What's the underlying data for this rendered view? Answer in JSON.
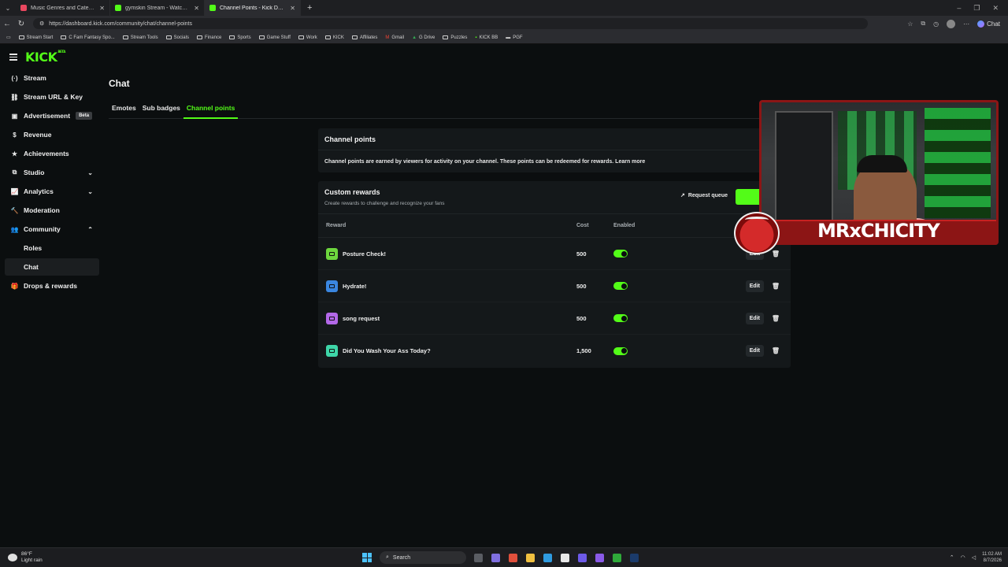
{
  "browser": {
    "tabs": [
      {
        "title": "Music Genres and Categories on /",
        "fav_color": "#e8475f",
        "active": false
      },
      {
        "title": "gymskin Stream - Watch Live",
        "fav_color": "#53fc18",
        "active": false
      },
      {
        "title": "Channel Points - Kick Dashboard",
        "fav_color": "#53fc18",
        "active": true
      }
    ],
    "url": "https://dashboard.kick.com/community/chat/channel-points",
    "chat_pill": "Chat",
    "bookmarks": [
      "Stream Start",
      "C Fam Fantasy Spo...",
      "Stream Tools",
      "Socials",
      "Finance",
      "Sports",
      "Game Stuff",
      "Work",
      "KICK",
      "Affiliates",
      "Gmail",
      "G Drive",
      "Puzzles",
      "KICK BB",
      "PGF"
    ]
  },
  "brand": {
    "logo": "KICK",
    "badge": "BETA",
    "accent": "#53fc18"
  },
  "sidebar": {
    "items": [
      {
        "label": "Stream",
        "icon": "(·)"
      },
      {
        "label": "Stream URL & Key",
        "icon": "⛓"
      },
      {
        "label": "Advertisement",
        "icon": "▣",
        "badge": "Beta"
      },
      {
        "label": "Revenue",
        "icon": "$"
      },
      {
        "label": "Achievements",
        "icon": "★"
      },
      {
        "label": "Studio",
        "icon": "⧉",
        "chevron": "⌄"
      },
      {
        "label": "Analytics",
        "icon": "📈",
        "chevron": "⌄"
      },
      {
        "label": "Moderation",
        "icon": "🔨"
      },
      {
        "label": "Community",
        "icon": "👥",
        "chevron": "⌃"
      },
      {
        "label": "Roles"
      },
      {
        "label": "Chat"
      },
      {
        "label": "Drops & rewards",
        "icon": "🎁"
      }
    ]
  },
  "page": {
    "title": "Chat",
    "tabs": [
      "Emotes",
      "Sub badges",
      "Channel points"
    ],
    "active_tab": "Channel points"
  },
  "channel_points": {
    "heading": "Channel points",
    "description": "Channel points are earned by viewers for activity on your channel. These points can be redeemed for rewards. Learn more"
  },
  "custom_rewards": {
    "heading": "Custom rewards",
    "subheading": "Create rewards to challenge and recognize your fans",
    "request_queue": "Request queue",
    "columns": {
      "reward": "Reward",
      "cost": "Cost",
      "enabled": "Enabled"
    },
    "rows": [
      {
        "name": "Posture Check!",
        "cost": "500",
        "enabled": true,
        "color": "#6dd63e",
        "edit": "Edit"
      },
      {
        "name": "Hydrate!",
        "cost": "500",
        "enabled": true,
        "color": "#3a86e0",
        "edit": "Edit"
      },
      {
        "name": "song request",
        "cost": "500",
        "enabled": true,
        "color": "#b368e8",
        "edit": "Edit"
      },
      {
        "name": "Did You Wash Your Ass Today?",
        "cost": "1,500",
        "enabled": true,
        "color": "#3ed6a8",
        "edit": "Edit"
      }
    ]
  },
  "overlay": {
    "name": "MRxCHICITY"
  },
  "taskbar": {
    "temp": "86°F",
    "weather": "Light rain",
    "search": "Search",
    "time": "11:02 AM",
    "date": "8/7/2026"
  }
}
